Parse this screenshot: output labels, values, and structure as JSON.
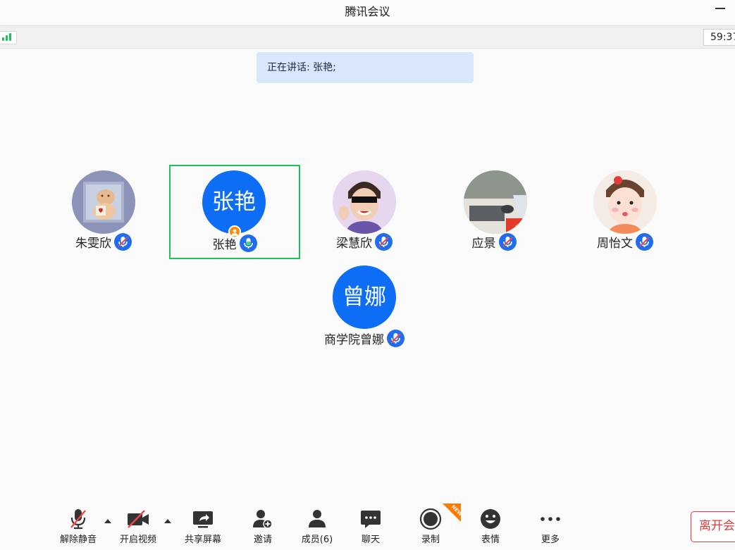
{
  "window": {
    "title": "腾讯会议"
  },
  "status": {
    "timer": "59:37"
  },
  "speaking_banner": "正在讲话: 张艳;",
  "participants": [
    {
      "name": "朱雯欣",
      "avatar_type": "photo",
      "avatar_icon": "sticker-photo",
      "mic": "muted"
    },
    {
      "name": "张艳",
      "avatar_type": "letters",
      "avatar_text": "张艳",
      "mic": "active",
      "speaking": true,
      "host": true
    },
    {
      "name": "梁慧欣",
      "avatar_type": "photo",
      "avatar_icon": "person-sunglasses-photo",
      "mic": "muted"
    },
    {
      "name": "应景",
      "avatar_type": "photo",
      "avatar_icon": "desk-photo",
      "mic": "muted"
    },
    {
      "name": "周怡文",
      "avatar_type": "photo",
      "avatar_icon": "baby-photo",
      "mic": "muted"
    },
    {
      "name": "商学院曾娜",
      "avatar_type": "letters",
      "avatar_text": "曾娜",
      "mic": "muted"
    }
  ],
  "toolbar": {
    "unmute": "解除静音",
    "start_video": "开启视频",
    "share_screen": "共享屏幕",
    "invite": "邀请",
    "members": "成员(6)",
    "chat": "聊天",
    "record": "录制",
    "record_badge": "NEW",
    "reactions": "表情",
    "more": "更多",
    "leave": "离开会议"
  },
  "colors": {
    "accent": "#0d6ef5",
    "speaking_border": "#1ec25b",
    "leave": "#e23a3a",
    "banner_bg": "#d8e7fb"
  }
}
